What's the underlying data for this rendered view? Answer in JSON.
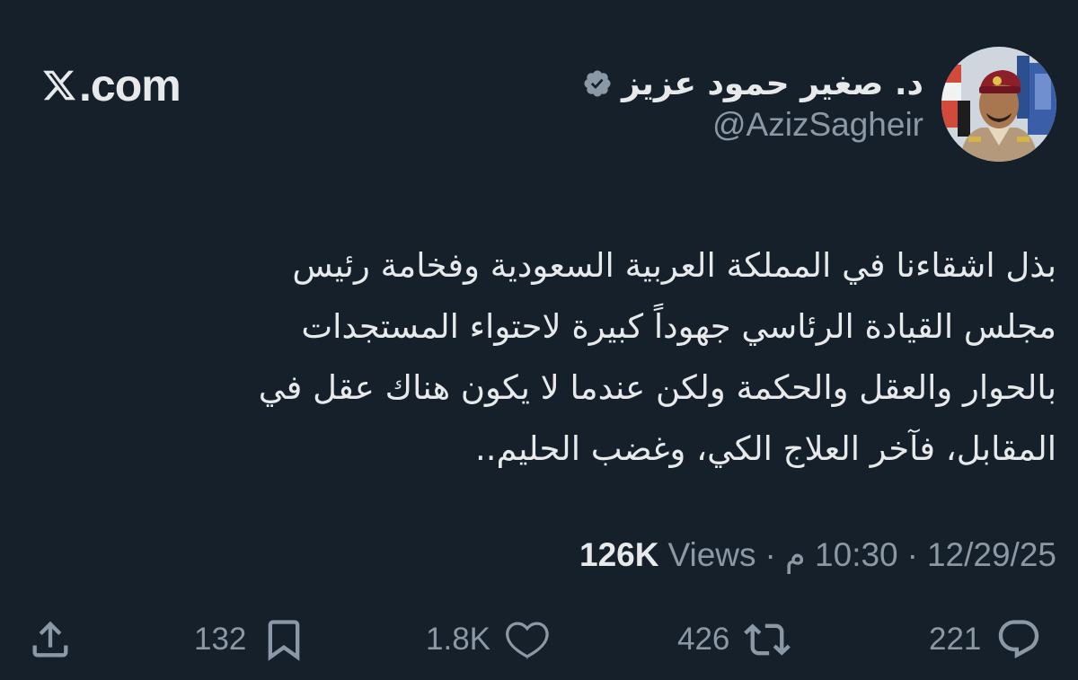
{
  "brand": {
    "text": ".com",
    "icon": "x-logo-icon"
  },
  "author": {
    "display_name": "د. صغير حمود عزيز",
    "handle": "@AzizSagheir",
    "verified_icon": "verified-badge-icon"
  },
  "tweet": {
    "text": "بذل اشقاءنا في المملكة العربية السعودية وفخامة رئيس\nمجلس القيادة الرئاسي جهوداً كبيرة لاحتواء المستجدات\nبالحوار والعقل والحكمة ولكن عندما لا يكون هناك عقل في\nالمقابل، فآخر العلاج الكي، وغضب الحليم.."
  },
  "meta": {
    "date": "12/29/25",
    "time": "10:30 م",
    "separator": "·",
    "views_count": "126K",
    "views_label": "Views"
  },
  "actions": {
    "reply": {
      "count": "221",
      "icon": "reply-icon"
    },
    "retweet": {
      "count": "426",
      "icon": "retweet-icon"
    },
    "like": {
      "count": "1.8K",
      "icon": "heart-icon"
    },
    "bookmark": {
      "count": "132",
      "icon": "bookmark-icon"
    },
    "share": {
      "icon": "share-icon"
    }
  },
  "colors": {
    "background": "#15202b",
    "text_primary": "#e7e9ea",
    "text_secondary": "#8b98a5"
  }
}
